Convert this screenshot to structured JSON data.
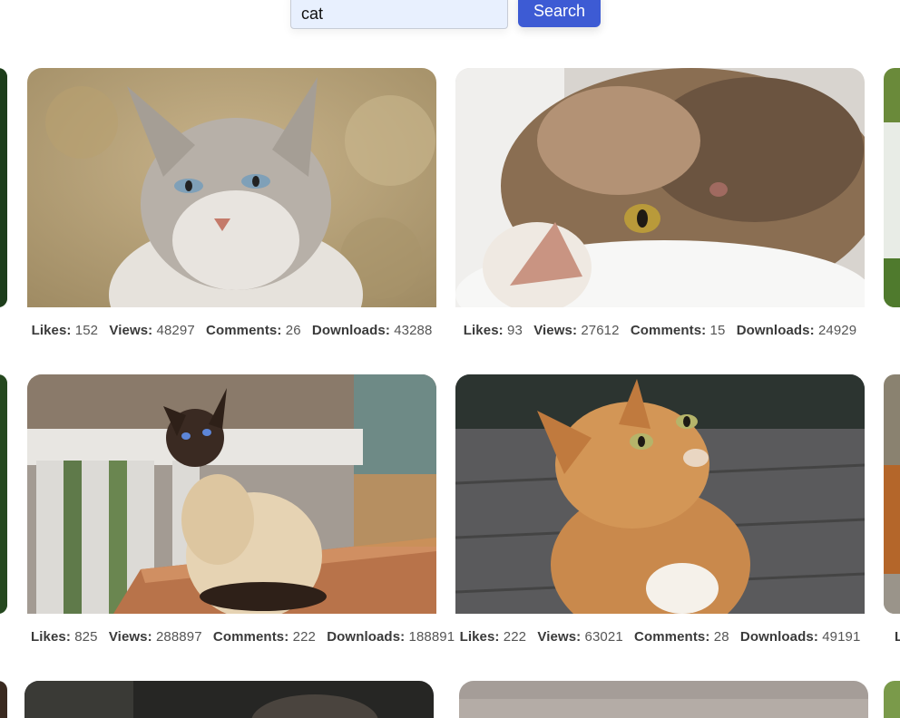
{
  "search": {
    "query": "cat",
    "button_label": "Search"
  },
  "labels": {
    "likes": "Likes:",
    "views": "Views:",
    "comments": "Comments:",
    "downloads": "Downloads:"
  },
  "cards": [
    {
      "likes": "152",
      "views": "48297",
      "comments": "26",
      "downloads": "43288"
    },
    {
      "likes": "93",
      "views": "27612",
      "comments": "15",
      "downloads": "24929"
    },
    {
      "likes": "825",
      "views": "288897",
      "comments": "222",
      "downloads": "188891"
    },
    {
      "likes": "222",
      "views": "63021",
      "comments": "28",
      "downloads": "49191"
    }
  ],
  "edge_partial_label": "L"
}
